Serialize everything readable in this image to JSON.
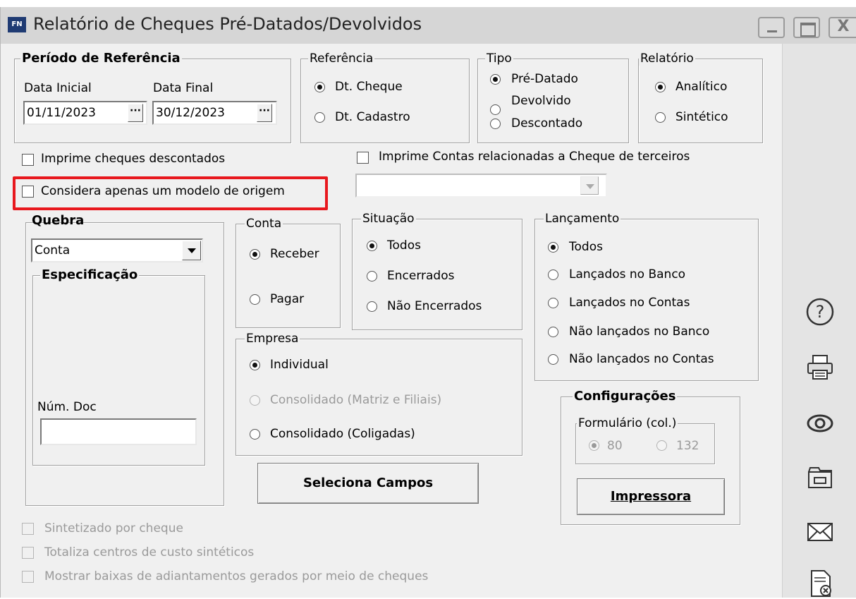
{
  "window": {
    "app_icon": "FN",
    "title": "Relatório de Cheques Pré-Datados/Devolvidos",
    "close_glyph": "X"
  },
  "periodo": {
    "legend": "Período de Referência",
    "data_inicial_label": "Data Inicial",
    "data_final_label": "Data Final",
    "data_inicial": "01/11/2023",
    "data_final": "30/12/2023",
    "picker_glyph": "···"
  },
  "referencia": {
    "legend": "Referência",
    "options": [
      "Dt. Cheque",
      "Dt. Cadastro"
    ],
    "selected": "Dt. Cheque"
  },
  "tipo": {
    "legend": "Tipo",
    "options": [
      "Pré-Datado",
      "Devolvido",
      "Descontado"
    ],
    "selected": "Pré-Datado"
  },
  "relatorio": {
    "legend": "Relatório",
    "options": [
      "Analítico",
      "Sintético"
    ],
    "selected": "Analítico"
  },
  "checks_top": {
    "imprime_descontados": "Imprime cheques descontados",
    "imprime_contas_terceiros": "Imprime Contas  relacionadas a Cheque de terceiros",
    "considera_modelo_origem": "Considera apenas um modelo de origem"
  },
  "quebra": {
    "legend": "Quebra",
    "selected": "Conta",
    "especificacao_legend": "Especificação",
    "num_doc_label": "Núm. Doc",
    "num_doc_value": ""
  },
  "conta": {
    "legend": "Conta",
    "options": [
      "Receber",
      "Pagar"
    ],
    "selected": "Receber"
  },
  "situacao": {
    "legend": "Situação",
    "options": [
      "Todos",
      "Encerrados",
      "Não Encerrados"
    ],
    "selected": "Todos"
  },
  "lancamento": {
    "legend": "Lançamento",
    "options": [
      "Todos",
      "Lançados no Banco",
      "Lançados no Contas",
      "Não lançados no Banco",
      "Não lançados no Contas"
    ],
    "selected": "Todos"
  },
  "empresa": {
    "legend": "Empresa",
    "options": [
      "Individual",
      "Consolidado (Matriz e Filiais)",
      "Consolidado (Coligadas)"
    ],
    "selected": "Individual"
  },
  "configuracoes": {
    "legend": "Configurações",
    "formulario_legend": "Formulário (col.)",
    "options": [
      "80",
      "132"
    ],
    "selected": "80",
    "impressora_button": "Impressora"
  },
  "buttons": {
    "seleciona_campos": "Seleciona Campos"
  },
  "checks_bottom": {
    "sintetizado": "Sintetizado por cheque",
    "totaliza": "Totaliza centros de custo sintéticos",
    "mostrar_baixas": "Mostrar baixas de adiantamentos gerados por meio de cheques"
  },
  "toolbar_icons": [
    "help-icon",
    "printer-icon",
    "preview-eye-icon",
    "folder-icon",
    "email-icon",
    "document-cancel-icon"
  ],
  "colors": {
    "highlight": "#e8181e",
    "window_bg": "#f0f0f0",
    "titlebar": "#d6d6d6"
  }
}
